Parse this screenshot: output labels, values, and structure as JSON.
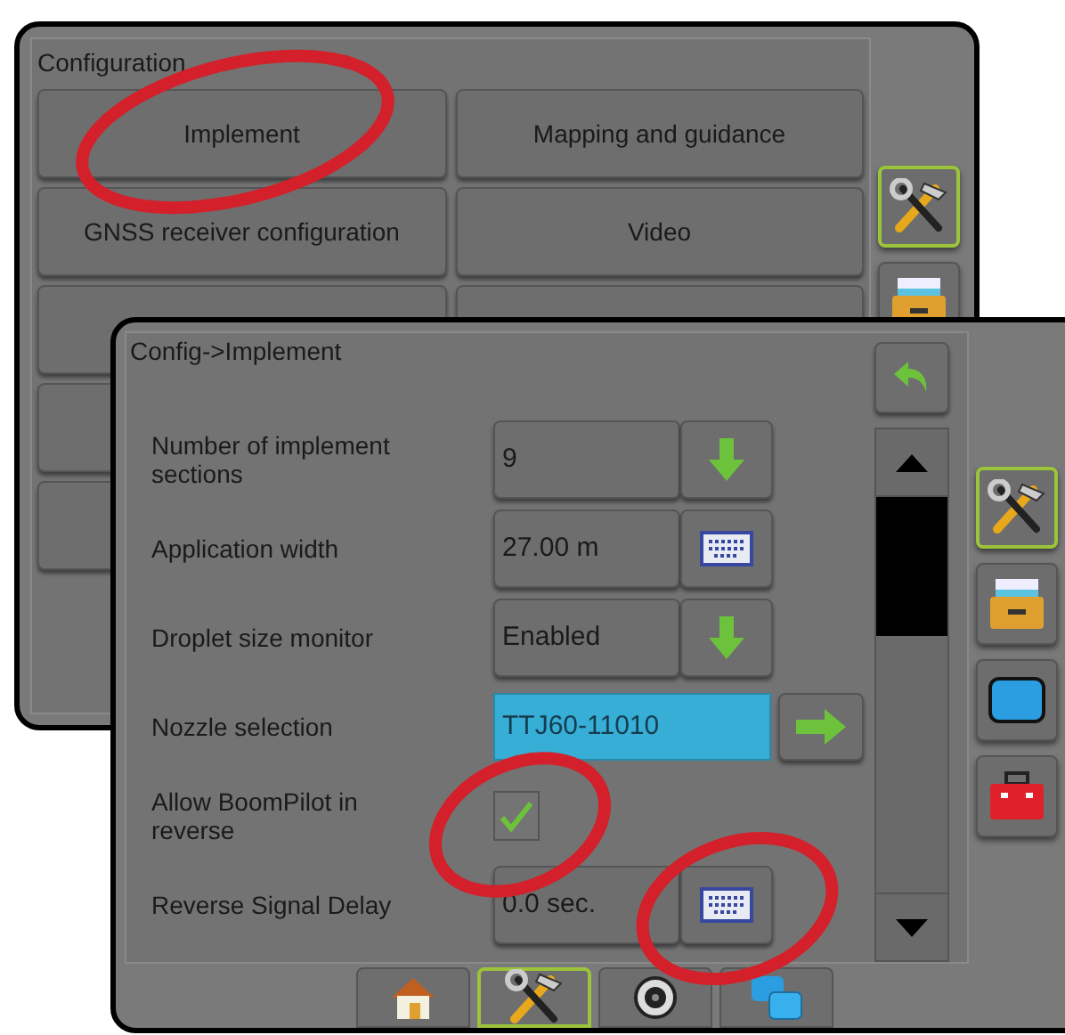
{
  "back_screen": {
    "title": "Configuration",
    "buttons": [
      {
        "label": "Implement"
      },
      {
        "label": "Mapping and guidance"
      },
      {
        "label": "GNSS receiver configuration"
      },
      {
        "label": "Video"
      }
    ],
    "side_tabs": [
      {
        "kind": "tools",
        "selected": true
      },
      {
        "kind": "cabinet",
        "selected": false
      }
    ]
  },
  "front_screen": {
    "title": "Config->Implement",
    "rows": [
      {
        "kind": "dropdown",
        "label": "Number of implement sections",
        "value": "9"
      },
      {
        "kind": "keyboard",
        "label": "Application width",
        "value": "27.00 m"
      },
      {
        "kind": "dropdown",
        "label": "Droplet size monitor",
        "value": "Enabled"
      },
      {
        "kind": "select",
        "label": "Nozzle selection",
        "value": "TTJ60-11010"
      },
      {
        "kind": "checkbox",
        "label": "Allow BoomPilot in reverse",
        "checked": true
      },
      {
        "kind": "keyboard",
        "label": "Reverse Signal Delay",
        "value": "0.0 sec."
      }
    ],
    "side_tabs": [
      {
        "kind": "tools",
        "selected": true
      },
      {
        "kind": "cabinet",
        "selected": false
      },
      {
        "kind": "screen",
        "selected": false
      },
      {
        "kind": "toolbox",
        "selected": false
      }
    ],
    "bottom_tabs": [
      {
        "kind": "home",
        "selected": false
      },
      {
        "kind": "tools",
        "selected": true
      },
      {
        "kind": "camera",
        "selected": false
      },
      {
        "kind": "layers",
        "selected": false
      }
    ]
  }
}
